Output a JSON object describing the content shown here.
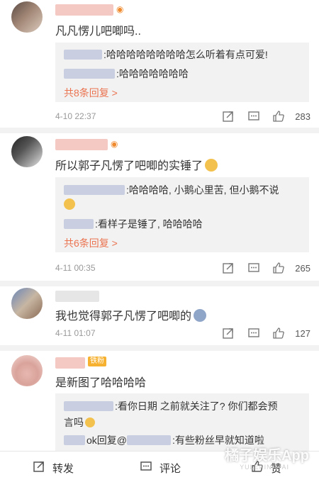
{
  "comments": [
    {
      "text": "凡凡愣儿吧唧吗..",
      "replies": [
        {
          "text": ":哈哈哈哈哈哈哈哈怎么听着有点可爱!"
        },
        {
          "text": ":哈哈哈哈哈哈哈"
        }
      ],
      "more": "共8条回复 >",
      "time": "4-10 22:37",
      "likes": "283"
    },
    {
      "text": "所以郭子凡愣了吧唧的实锤了",
      "replies": [
        {
          "text": ":哈哈哈哈, 小鹅心里苦, 但小鹅不说"
        },
        {
          "text": ":看样子是锤了, 哈哈哈哈"
        }
      ],
      "more": "共6条回复 >",
      "time": "4-11 00:35",
      "likes": "265"
    },
    {
      "text": "我也觉得郭子凡愣了吧唧的",
      "time": "4-11 01:07",
      "likes": "127"
    },
    {
      "badge": "铁粉",
      "text": "是新图了哈哈哈哈",
      "replies": [
        {
          "text": ":看你日期 之前就关注了? 你们都会预"
        },
        {
          "text": "言吗"
        },
        {
          "text_pre": "ok回复@",
          "text": ":有些粉丝早就知道啦"
        }
      ]
    }
  ],
  "bottom_bar": {
    "repost": "转发",
    "comment": "评论",
    "like": "赞"
  },
  "watermark": {
    "main": "橘子娱乐App",
    "sub": "YULEPINGTAI"
  }
}
